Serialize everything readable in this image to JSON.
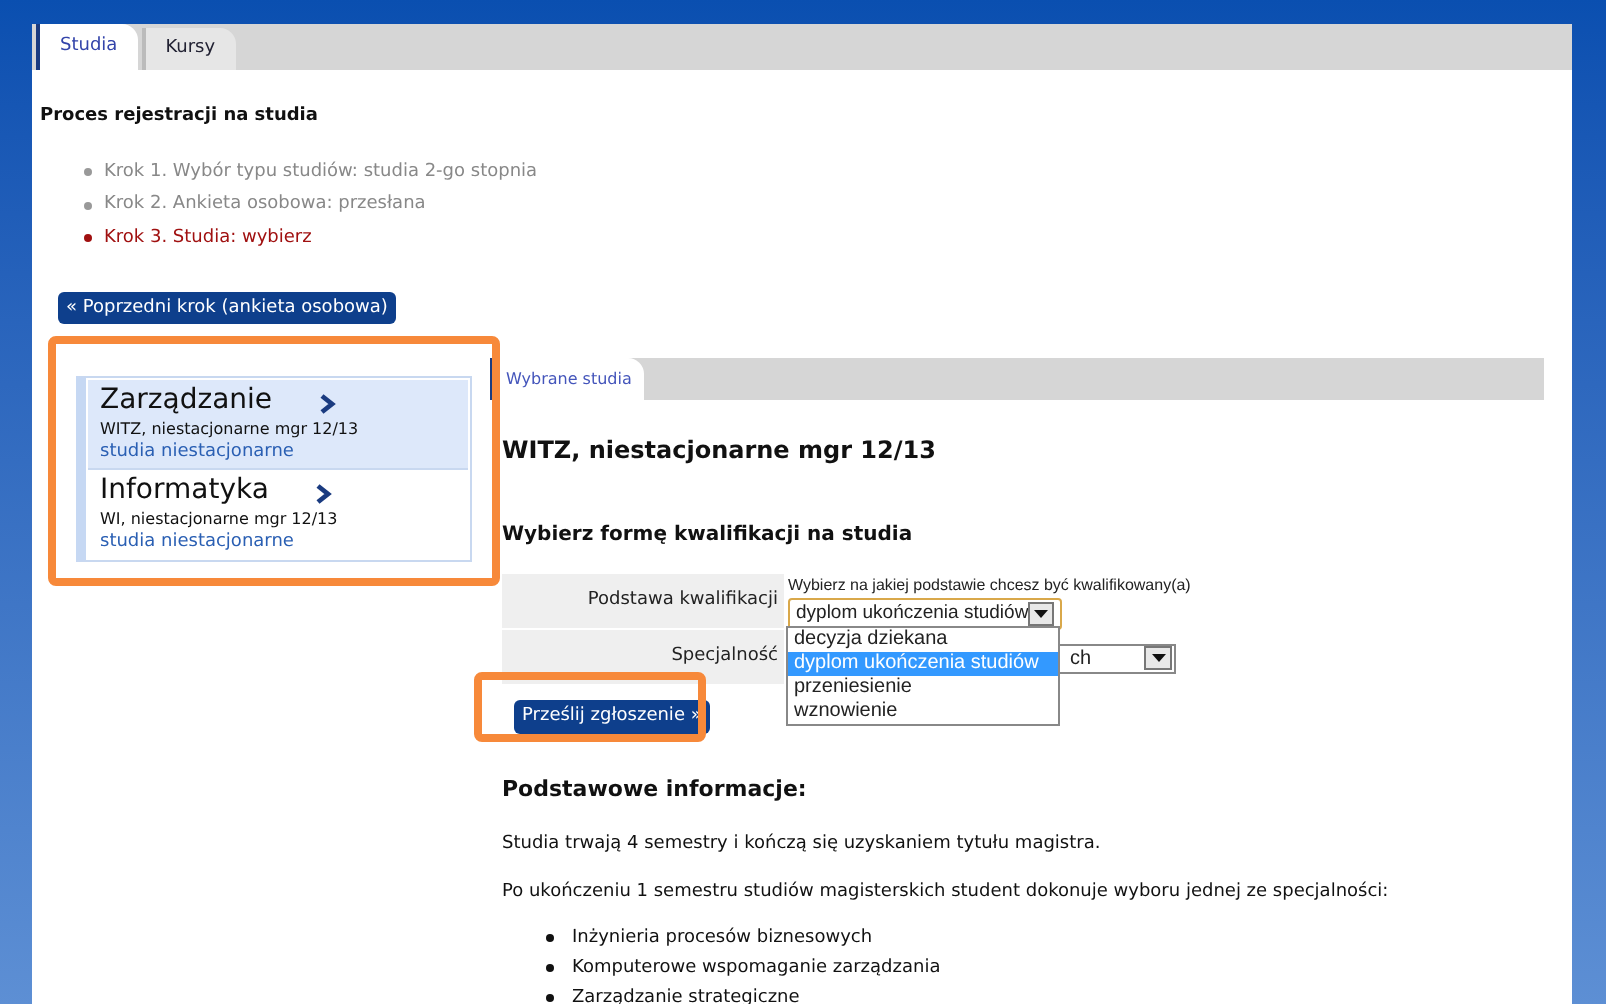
{
  "tabs": [
    {
      "label": "Studia",
      "selected": true
    },
    {
      "label": "Kursy",
      "selected": false
    }
  ],
  "process": {
    "title": "Proces rejestracji na studia",
    "steps": [
      {
        "label": "Krok 1. Wybór typu studiów: studia 2-go stopnia",
        "current": false
      },
      {
        "label": "Krok 2. Ankieta osobowa: przesłana",
        "current": false
      },
      {
        "label": "Krok 3. Studia: wybierz",
        "current": true
      }
    ],
    "back_button": "« Poprzedni krok (ankieta osobowa)"
  },
  "studies": [
    {
      "name": "Zarządzanie",
      "code": "WITZ, niestacjonarne mgr 12/13",
      "mode": "studia niestacjonarne",
      "selected": true
    },
    {
      "name": "Informatyka",
      "code": "WI, niestacjonarne mgr 12/13",
      "mode": "studia niestacjonarne",
      "selected": false
    }
  ],
  "detail_tabs": [
    {
      "label": "Wybrane studia",
      "selected": true
    }
  ],
  "heading": "WITZ, niestacjonarne mgr 12/13",
  "form_heading": "Wybierz formę kwalifikacji na studia",
  "form": {
    "hint": "Wybierz na jakiej podstawie chcesz być kwalifikowany(a)",
    "fields": [
      {
        "label": "Podstawa kwalifikacji",
        "value": "dyplom ukończenia studiów",
        "expanded": true
      },
      {
        "label": "Specjalność",
        "value": "ch",
        "expanded": false
      }
    ],
    "options": [
      {
        "label": "decyzja dziekana",
        "selected": false
      },
      {
        "label": "dyplom ukończenia studiów",
        "selected": true
      },
      {
        "label": "przeniesienie",
        "selected": false
      },
      {
        "label": "wznowienie",
        "selected": false
      }
    ],
    "submit": "Prześlij zgłoszenie »"
  },
  "info": {
    "title": "Podstawowe informacje:",
    "paragraphs": [
      "Studia trwają 4 semestry i kończą się uzyskaniem tytułu magistra.",
      "Po ukończeniu 1 semestru studiów magisterskich student dokonuje wyboru jednej ze specjalności:"
    ],
    "specializations": [
      "Inżynieria procesów biznesowych",
      "Komputerowe wspomaganie zarządzania",
      "Zarządzanie strategiczne"
    ]
  }
}
